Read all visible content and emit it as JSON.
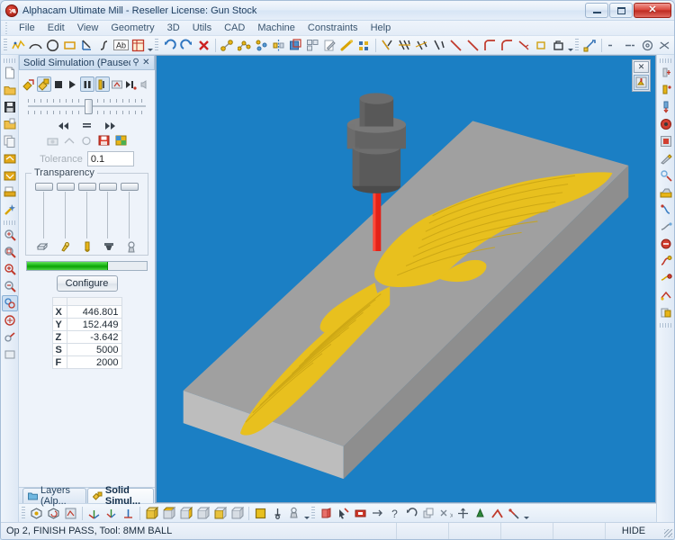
{
  "window": {
    "title": "Alphacam Ultimate Mill - Reseller License: Gun Stock",
    "logo_icon": "alphacam-logo-icon",
    "minimize_label": "Minimize",
    "maximize_label": "Maximize",
    "close_label": "Close"
  },
  "menubar": {
    "items": [
      {
        "label": "File"
      },
      {
        "label": "Edit"
      },
      {
        "label": "View"
      },
      {
        "label": "Geometry"
      },
      {
        "label": "3D"
      },
      {
        "label": "Utils"
      },
      {
        "label": "CAD"
      },
      {
        "label": "Machine"
      },
      {
        "label": "Constraints"
      },
      {
        "label": "Help"
      }
    ]
  },
  "top_toolbar": {
    "groups": [
      {
        "name": "geometry",
        "buttons": [
          {
            "icon": "polyline-icon"
          },
          {
            "icon": "arc-icon"
          },
          {
            "icon": "circle-icon"
          },
          {
            "icon": "rectangle-icon"
          },
          {
            "icon": "angle-line-icon"
          },
          {
            "icon": "spline-icon"
          },
          {
            "icon": "text-ab-icon"
          },
          {
            "icon": "nest-frame-icon"
          }
        ]
      },
      {
        "name": "edit",
        "buttons": [
          {
            "icon": "undo-icon"
          },
          {
            "icon": "redo-icon"
          },
          {
            "icon": "delete-x-icon"
          },
          {
            "icon": "node-edit-icon"
          },
          {
            "icon": "node-move-icon"
          },
          {
            "icon": "node-insert-icon"
          },
          {
            "icon": "mirror-icon"
          },
          {
            "icon": "scale-icon"
          },
          {
            "icon": "array-icon"
          },
          {
            "icon": "edit-pencil-icon"
          },
          {
            "icon": "measure-icon"
          },
          {
            "icon": "grid-icon"
          }
        ]
      },
      {
        "name": "trim",
        "buttons": [
          {
            "icon": "trim-icon"
          },
          {
            "icon": "trim-multi-icon"
          },
          {
            "icon": "extend-icon"
          },
          {
            "icon": "break-icon"
          },
          {
            "icon": "chamfer-line-icon"
          },
          {
            "icon": "line-icon"
          },
          {
            "icon": "corner-icon"
          },
          {
            "icon": "fillet-icon"
          },
          {
            "icon": "round-corner-icon"
          },
          {
            "icon": "arrow-tool-icon"
          },
          {
            "icon": "square-tool-icon"
          },
          {
            "icon": "box-tool-icon"
          }
        ]
      },
      {
        "name": "constraints",
        "buttons": [
          {
            "icon": "constraint-icon"
          },
          {
            "icon": "horizontal-icon"
          },
          {
            "icon": "vertical-icon"
          },
          {
            "icon": "concentric-icon"
          },
          {
            "icon": "perpendicular-icon"
          },
          {
            "icon": "tangent-icon"
          },
          {
            "icon": "parallel-icon"
          },
          {
            "icon": "unequal-icon"
          },
          {
            "icon": "circle-constraint-icon"
          }
        ]
      }
    ]
  },
  "left_toolbar": {
    "buttons": [
      {
        "icon": "new-file-icon"
      },
      {
        "icon": "open-folder-icon"
      },
      {
        "icon": "save-disk-icon"
      },
      {
        "icon": "open-recent-icon"
      },
      {
        "icon": "copy-page-icon"
      },
      {
        "icon": "import-dxf-icon"
      },
      {
        "icon": "export-dxf-icon"
      },
      {
        "icon": "print-page-icon"
      },
      {
        "icon": "wizard-wand-icon"
      },
      {
        "icon": "zoom-all-icon"
      },
      {
        "icon": "zoom-window-icon"
      },
      {
        "icon": "zoom-in-icon"
      },
      {
        "icon": "zoom-out-icon"
      },
      {
        "icon": "pan-icon"
      },
      {
        "icon": "redraw-icon"
      },
      {
        "icon": "view-rotate-icon"
      },
      {
        "icon": "layer-icon"
      }
    ]
  },
  "right_toolbar": {
    "buttons": [
      {
        "icon": "tool-add-icon"
      },
      {
        "icon": "tool-select-icon"
      },
      {
        "icon": "drill-down-icon"
      },
      {
        "icon": "pocket-icon"
      },
      {
        "icon": "profile-icon"
      },
      {
        "icon": "engrave-icon"
      },
      {
        "icon": "rough-icon"
      },
      {
        "icon": "finish-icon"
      },
      {
        "icon": "simulate-icon"
      },
      {
        "icon": "path-link-icon"
      },
      {
        "icon": "post-process-icon"
      },
      {
        "icon": "nc-output-icon"
      },
      {
        "icon": "tool-library-icon"
      },
      {
        "icon": "machine-setup-icon"
      },
      {
        "icon": "material-icon"
      }
    ]
  },
  "panel": {
    "title": "Solid Simulation (Paused)",
    "pin_icon": "pin-icon",
    "close_icon": "close-icon",
    "sim_buttons": [
      {
        "icon": "simulate-start-icon",
        "pressed": false
      },
      {
        "icon": "simulate-step-icon",
        "pressed": true
      },
      {
        "icon": "stop-square-icon",
        "pressed": false
      },
      {
        "icon": "play-triangle-icon",
        "pressed": false
      },
      {
        "icon": "pause-bars-icon",
        "pressed": true
      },
      {
        "icon": "single-step-icon",
        "pressed": true
      },
      {
        "icon": "fast-sim-icon",
        "pressed": false
      },
      {
        "icon": "skip-end-icon",
        "pressed": false
      },
      {
        "icon": "sound-icon",
        "pressed": false
      }
    ],
    "speed_slider": {
      "name": "simulation-speed-slider",
      "position_pct": 48
    },
    "nav_buttons": [
      {
        "icon": "rewind-icon"
      },
      {
        "icon": "stop-lines-icon"
      },
      {
        "icon": "forward-icon"
      }
    ],
    "mini_buttons": [
      {
        "icon": "camera-icon"
      },
      {
        "icon": "compare-icon"
      },
      {
        "icon": "analyse-icon"
      },
      {
        "icon": "save-sim-icon"
      },
      {
        "icon": "image-export-icon"
      }
    ],
    "tolerance": {
      "label": "Tolerance",
      "value": "0.1"
    },
    "transparency": {
      "label": "Transparency",
      "sliders": [
        {
          "name": "transparency-stock-slider",
          "icon": "stock-block-icon",
          "position_pct": 0
        },
        {
          "name": "transparency-fixture-slider",
          "icon": "fixture-clamp-icon",
          "position_pct": 0
        },
        {
          "name": "transparency-tool-slider",
          "icon": "tool-bit-icon",
          "position_pct": 0
        },
        {
          "name": "transparency-holder-slider",
          "icon": "tool-holder-icon",
          "position_pct": 0
        },
        {
          "name": "transparency-machine-slider",
          "icon": "machine-part-icon",
          "position_pct": 0
        }
      ]
    },
    "progress": {
      "name": "simulation-progress",
      "value_pct": 68
    },
    "configure_button": "Configure",
    "coordinates": {
      "rows": [
        {
          "label": "X",
          "value": "446.801"
        },
        {
          "label": "Y",
          "value": "152.449"
        },
        {
          "label": "Z",
          "value": "-3.642"
        },
        {
          "label": "S",
          "value": "5000"
        },
        {
          "label": "F",
          "value": "2000"
        }
      ]
    }
  },
  "viewport": {
    "background_color": "#1b7fc4",
    "stock_color": "#9a9a9a",
    "toolpath_color": "#e8c01e",
    "tool_holder_color": "#5a5a5a",
    "tool_color": "#e32219",
    "float_toolbar": {
      "close_icon": "close-icon",
      "button_icon": "simulation-view-icon"
    }
  },
  "panel_tabs": [
    {
      "label": "Layers (Alp...",
      "icon": "layers-icon",
      "active": false
    },
    {
      "label": "Solid Simul...",
      "icon": "solid-sim-icon",
      "active": true
    }
  ],
  "bottom_toolbar": {
    "groups": [
      {
        "name": "view-3d",
        "buttons": [
          {
            "icon": "iso-view-icon"
          },
          {
            "icon": "rotate-view-icon"
          },
          {
            "icon": "dynamic-view-icon"
          },
          {
            "icon": "axis-xy-icon"
          },
          {
            "icon": "axis-iso-icon"
          },
          {
            "icon": "axis-z-icon"
          },
          {
            "icon": "box-front-icon"
          },
          {
            "icon": "box-top-icon"
          },
          {
            "icon": "box-side-icon"
          },
          {
            "icon": "box-back-icon"
          },
          {
            "icon": "box-bottom-icon"
          },
          {
            "icon": "box-left-icon"
          },
          {
            "icon": "shade-solid-icon"
          },
          {
            "icon": "plane-origin-icon"
          },
          {
            "icon": "material-view-icon"
          }
        ]
      },
      {
        "name": "machining",
        "buttons": [
          {
            "icon": "stock-define-icon"
          },
          {
            "icon": "tool-pointer-icon"
          },
          {
            "icon": "red-square-icon"
          },
          {
            "icon": "flip-icon"
          },
          {
            "icon": "query-icon"
          },
          {
            "icon": "rotate-ccw-icon"
          },
          {
            "icon": "copy-layer-icon"
          },
          {
            "icon": "delete-path-icon"
          },
          {
            "icon": "move-path-icon"
          },
          {
            "icon": "insert-op-icon"
          },
          {
            "icon": "corner-path-icon"
          },
          {
            "icon": "edit-op-icon"
          }
        ]
      }
    ]
  },
  "statusbar": {
    "message": "Op 2, FINISH PASS, Tool: 8MM BALL",
    "cells": [
      "",
      "",
      "",
      ""
    ],
    "hide_label": "HIDE"
  }
}
